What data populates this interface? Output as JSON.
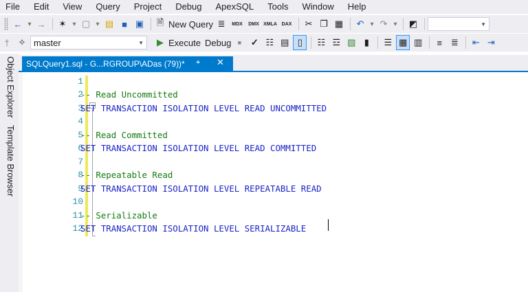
{
  "menu": [
    "File",
    "Edit",
    "View",
    "Query",
    "Project",
    "Debug",
    "ApexSQL",
    "Tools",
    "Window",
    "Help"
  ],
  "toolbar1": {
    "new_query_label": "New Query",
    "file_type_labels": [
      "MDX",
      "DMX",
      "XMLA",
      "DAX"
    ],
    "icons": [
      "back-icon",
      "forward-icon",
      "new-project-icon",
      "add-item-icon",
      "open-file-icon",
      "save-icon",
      "save-all-icon",
      "cut-icon",
      "copy-icon",
      "paste-icon",
      "undo-icon",
      "redo-icon",
      "activity-monitor-icon"
    ]
  },
  "toolbar2": {
    "database": "master",
    "execute_label": "Execute",
    "debug_label": "Debug",
    "icons": [
      "connect-icon",
      "filter-icon",
      "stop-icon",
      "parse-checkmark-icon",
      "estimated-plan-icon",
      "intellisense-icon",
      "query-options-icon",
      "actual-plan-icon",
      "live-stats-icon",
      "client-stats-icon",
      "results-text-icon",
      "results-grid-icon",
      "results-file-icon",
      "comment-icon",
      "uncomment-icon",
      "decrease-indent-icon",
      "increase-indent-icon"
    ]
  },
  "side_tabs": [
    "Object Explorer",
    "Template Browser"
  ],
  "document_tab": {
    "title": "SQLQuery1.sql - G...RGROUP\\ADas (79))*",
    "active_color": "#007acc"
  },
  "editor": {
    "line_numbers": [
      "1",
      "2",
      "3",
      "4",
      "5",
      "6",
      "7",
      "8",
      "9",
      "10",
      "11",
      "12"
    ],
    "lines": [
      {
        "text": "",
        "kind": "blank"
      },
      {
        "text": "-- Read Uncommitted",
        "kind": "comment"
      },
      {
        "text": "SET TRANSACTION ISOLATION LEVEL READ UNCOMMITTED",
        "kind": "keyword"
      },
      {
        "text": "",
        "kind": "blank"
      },
      {
        "text": "-- Read Committed",
        "kind": "comment"
      },
      {
        "text": "SET TRANSACTION ISOLATION LEVEL READ COMMITTED",
        "kind": "keyword"
      },
      {
        "text": "",
        "kind": "blank"
      },
      {
        "text": "-- Repeatable Read",
        "kind": "comment"
      },
      {
        "text": "SET TRANSACTION ISOLATION LEVEL REPEATABLE READ",
        "kind": "keyword"
      },
      {
        "text": "",
        "kind": "blank"
      },
      {
        "text": "-- Serializable",
        "kind": "comment"
      },
      {
        "text": "SET TRANSACTION ISOLATION LEVEL SERIALIZABLE",
        "kind": "keyword"
      }
    ],
    "colors": {
      "comment": "#137a13",
      "keyword": "#1a22c8",
      "line_number": "#2b91af",
      "change_bar": "#efe85a"
    }
  }
}
